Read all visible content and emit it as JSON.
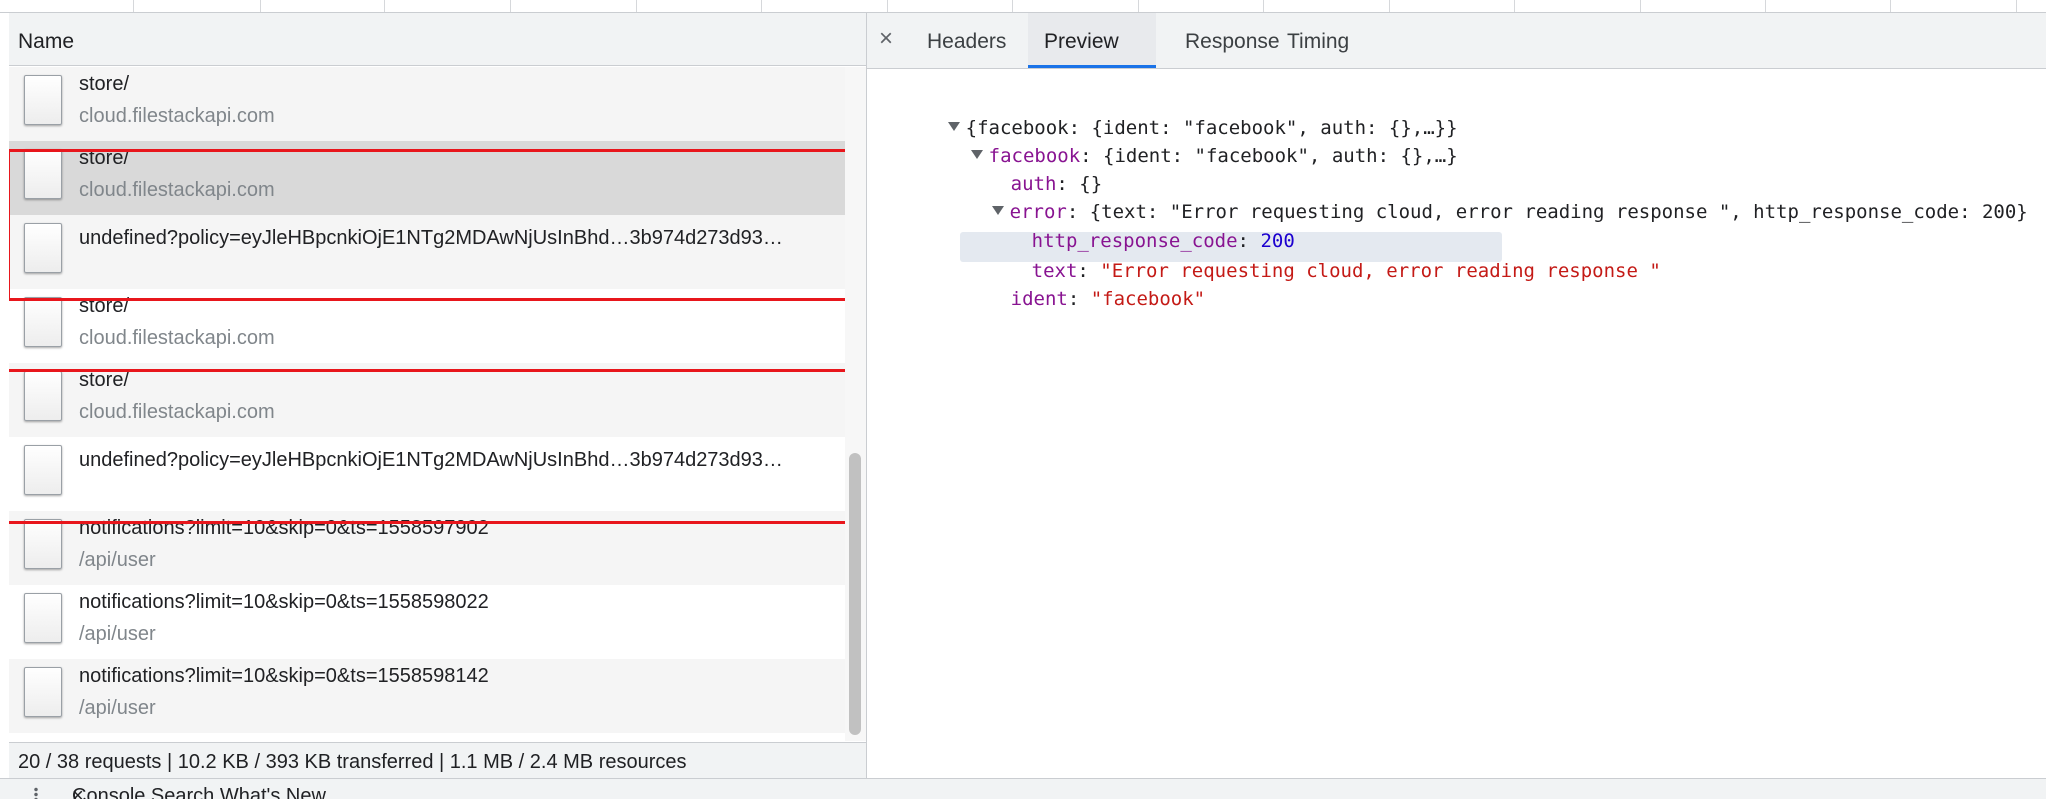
{
  "network": {
    "name_header": "Name",
    "requests": [
      {
        "title": "store/",
        "subtitle": "cloud.filestackapi.com"
      },
      {
        "title": "store/",
        "subtitle": "cloud.filestackapi.com"
      },
      {
        "title": "undefined?policy=eyJleHBpcnkiOjE1NTg2MDAwNjUsInBhd…3b974d273d93…",
        "subtitle": ""
      },
      {
        "title": "store/",
        "subtitle": "cloud.filestackapi.com"
      },
      {
        "title": "store/",
        "subtitle": "cloud.filestackapi.com"
      },
      {
        "title": "undefined?policy=eyJleHBpcnkiOjE1NTg2MDAwNjUsInBhd…3b974d273d93…",
        "subtitle": ""
      },
      {
        "title": "notifications?limit=10&skip=0&ts=1558597902",
        "subtitle": "/api/user"
      },
      {
        "title": "notifications?limit=10&skip=0&ts=1558598022",
        "subtitle": "/api/user"
      },
      {
        "title": "notifications?limit=10&skip=0&ts=1558598142",
        "subtitle": "/api/user"
      }
    ],
    "status": "20 / 38 requests | 10.2 KB / 393 KB transferred | 1.1 MB / 2.4 MB resources"
  },
  "details": {
    "close_symbol": "×",
    "tabs": [
      {
        "label": "Headers"
      },
      {
        "label": "Preview"
      },
      {
        "label": "Response"
      },
      {
        "label": "Timing"
      }
    ],
    "active_tab": "Preview",
    "preview": {
      "root": "{facebook: {ident: \"facebook\", auth: {},…}}",
      "facebook_key": "facebook",
      "facebook_summary": ": {ident: \"facebook\", auth: {},…}",
      "auth_key": "auth",
      "auth_value": ": {}",
      "error_key": "error",
      "error_summary": ": {text: \"Error requesting cloud, error reading response \", http_response_code: 200}",
      "http_key": "http_response_code",
      "http_sep": ": ",
      "http_value": "200",
      "text_key": "text",
      "text_sep": ": ",
      "text_value": "\"Error requesting cloud, error reading response \"",
      "ident_key": "ident",
      "ident_sep": ": ",
      "ident_value": "\"facebook\""
    }
  },
  "drawer": {
    "label": "Console    Search    What's New"
  },
  "colors": {
    "highlight_border": "#e8161c",
    "active_tab_underline": "#1a73e8",
    "json_key": "#881391",
    "json_string": "#c41a16",
    "json_number": "#1c00cf"
  }
}
